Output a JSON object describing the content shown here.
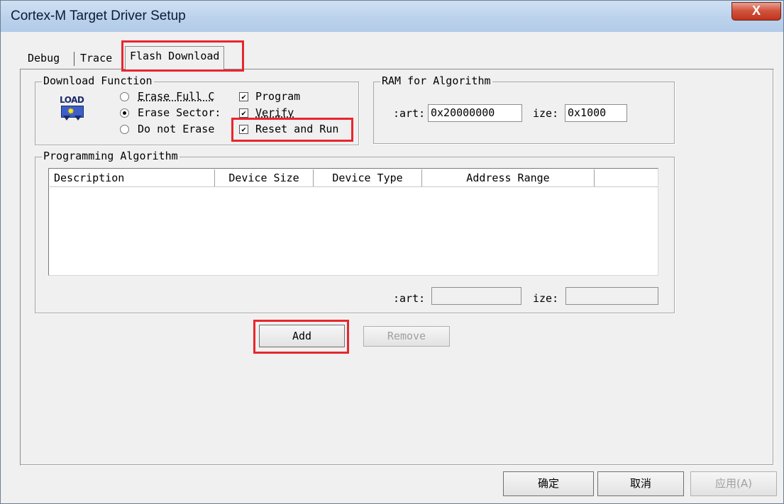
{
  "window": {
    "title": "Cortex-M Target Driver Setup",
    "close_label": "X"
  },
  "tabs": [
    {
      "label": "Debug"
    },
    {
      "label": "Trace"
    },
    {
      "label": "Flash Download"
    }
  ],
  "download_function": {
    "legend": "Download Function",
    "icon_text": "LOAD",
    "radios": [
      {
        "label": "Erase Full C",
        "checked": false
      },
      {
        "label": "Erase Sector:",
        "checked": true
      },
      {
        "label": "Do not Erase",
        "checked": false
      }
    ],
    "checkboxes": [
      {
        "label": "Program",
        "checked": true
      },
      {
        "label": "Verify",
        "checked": true
      },
      {
        "label": "Reset and Run",
        "checked": true
      }
    ]
  },
  "ram_for_algorithm": {
    "legend": "RAM for Algorithm",
    "start_label": ":art:",
    "start_value": "0x20000000",
    "size_label": "ize:",
    "size_value": "0x1000"
  },
  "programming_algorithm": {
    "legend": "Programming Algorithm",
    "columns": [
      "Description",
      "Device Size",
      "Device Type",
      "Address Range"
    ],
    "rows": [],
    "start_label": ":art:",
    "start_value": "",
    "size_label": "ize:",
    "size_value": ""
  },
  "buttons": {
    "add": "Add",
    "remove": "Remove"
  },
  "footer": {
    "ok": "确定",
    "cancel": "取消",
    "apply": "应用(A)"
  },
  "colors": {
    "highlight": "#e8262d",
    "dialog_bg": "#f0f0f0"
  }
}
